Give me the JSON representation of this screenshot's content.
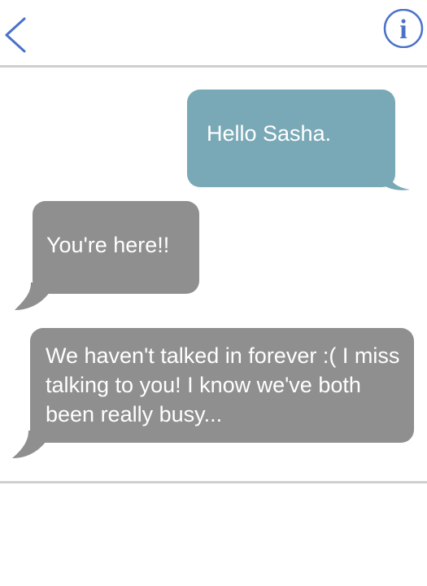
{
  "header": {
    "back_icon": "chevron-left-icon",
    "info_icon": "info-circle-icon",
    "info_glyph": "i",
    "accent_color": "#4a72c8"
  },
  "messages": [
    {
      "direction": "outgoing",
      "text": "Hello Sasha.",
      "color": "#79a9b6"
    },
    {
      "direction": "incoming",
      "text": "You're here!!",
      "color": "#8f8f8f"
    },
    {
      "direction": "incoming",
      "text": "We haven't talked in forever :( I miss talking to you! I know we've both been really busy...",
      "color": "#8f8f8f"
    }
  ]
}
